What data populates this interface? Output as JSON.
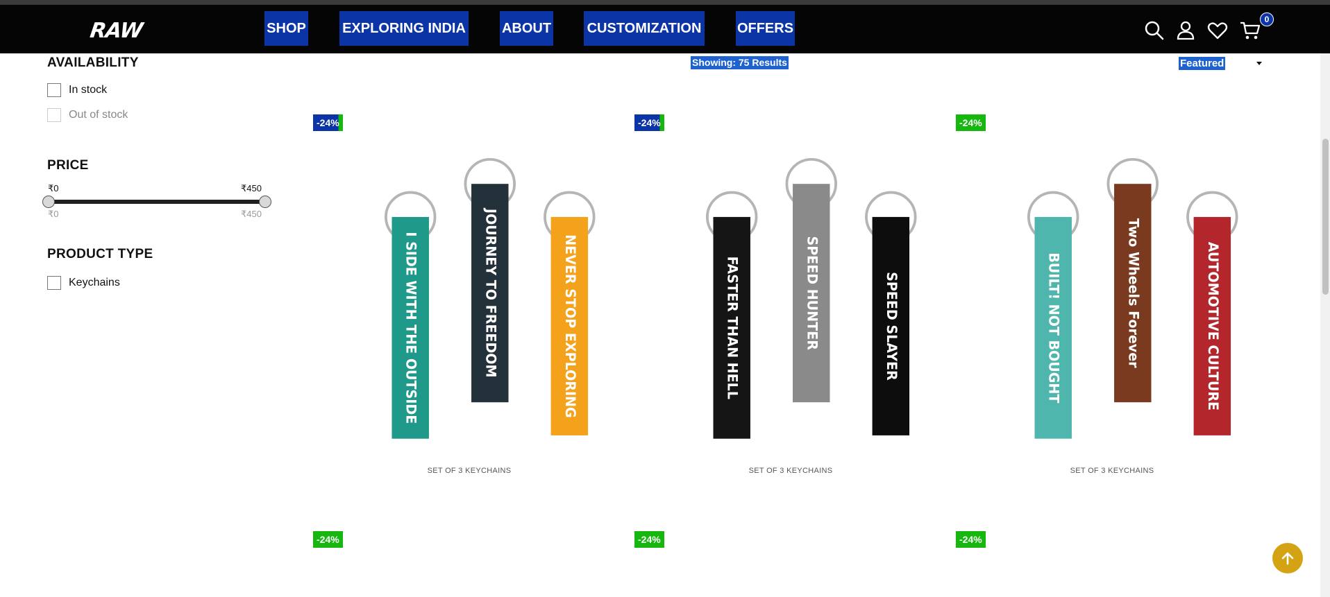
{
  "brand": {
    "logo_text": "RAW"
  },
  "nav": {
    "items": [
      {
        "label": "SHOP"
      },
      {
        "label": "EXPLORING INDIA"
      },
      {
        "label": "ABOUT"
      },
      {
        "label": "CUSTOMIZATION"
      },
      {
        "label": "OFFERS"
      }
    ]
  },
  "header_icons": [
    "search-icon",
    "user-icon",
    "heart-icon",
    "cart-icon"
  ],
  "cart": {
    "count": "0"
  },
  "filters": {
    "availability": {
      "title": "AVAILABILITY",
      "options": [
        {
          "label": "In stock"
        },
        {
          "label": "Out of stock"
        }
      ]
    },
    "price": {
      "title": "PRICE",
      "min_label": "₹0",
      "max_label": "₹450",
      "min_sub": "₹0",
      "max_sub": "₹450",
      "range_min": 0,
      "range_max": 450,
      "selected_min": 0,
      "selected_max": 450
    },
    "product_type": {
      "title": "PRODUCT TYPE",
      "options": [
        {
          "label": "Keychains"
        }
      ]
    }
  },
  "results": {
    "text": "Showing: 75 Results"
  },
  "sort": {
    "selected": "Featured"
  },
  "products": [
    {
      "discount": "-24%",
      "name": "SET OF 3 KEYCHAINS",
      "straps": [
        {
          "text": "I SIDE WITH THE OUTSIDE",
          "color": "#1f9a8a"
        },
        {
          "text": "JOURNEY TO FREEDOM",
          "color": "#23313b"
        },
        {
          "text": "NEVER STOP EXPLORING",
          "color": "#f4a21c"
        }
      ]
    },
    {
      "discount": "-24%",
      "name": "SET OF 3 KEYCHAINS",
      "straps": [
        {
          "text": "FASTER THAN HELL",
          "color": "#151515"
        },
        {
          "text": "SPEED HUNTER",
          "color": "#8a8a8a"
        },
        {
          "text": "SPEED SLAYER",
          "color": "#0d0d0d"
        }
      ]
    },
    {
      "discount": "-24%",
      "name": "SET OF 3 KEYCHAINS",
      "straps": [
        {
          "text": "BUILT! NOT BOUGHT",
          "color": "#4fb6ae"
        },
        {
          "text": "Two Wheels Forever",
          "color": "#7a3a1f"
        },
        {
          "text": "AUTOMOTIVE CULTURE",
          "color": "#b3262b"
        }
      ]
    },
    {
      "discount": "-24%"
    },
    {
      "discount": "-24%"
    },
    {
      "discount": "-24%"
    }
  ]
}
